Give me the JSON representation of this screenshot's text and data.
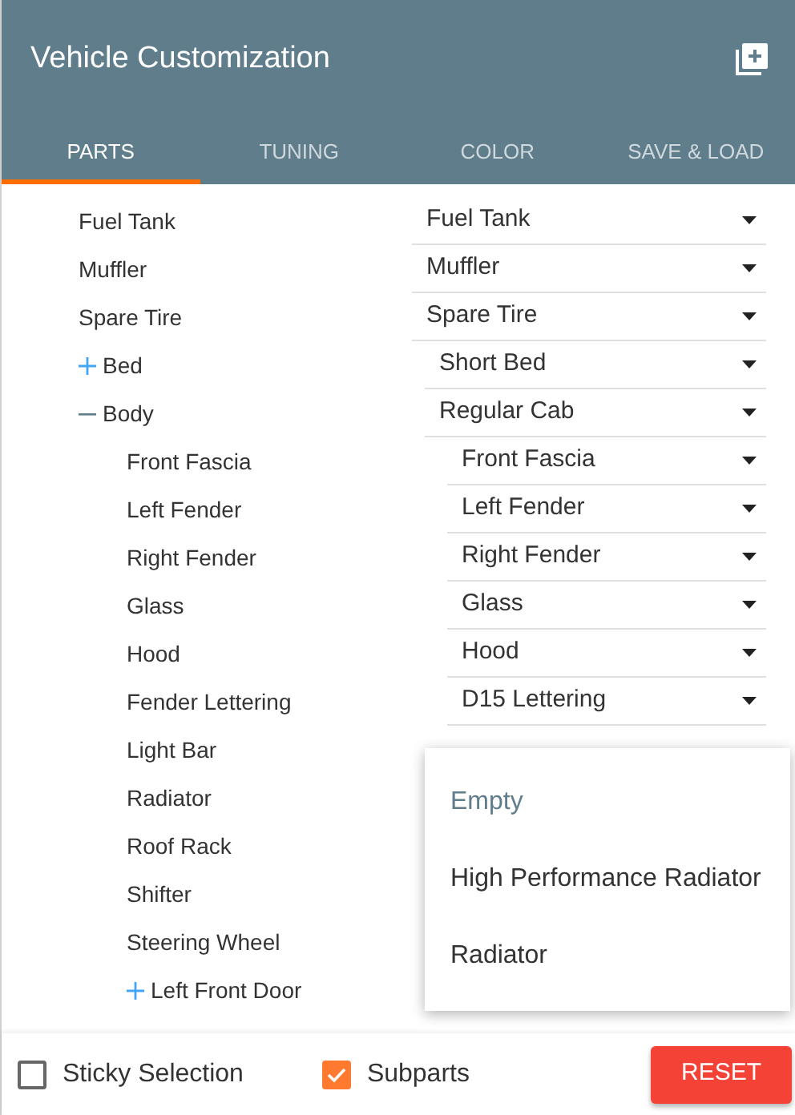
{
  "header": {
    "title": "Vehicle Customization"
  },
  "tabs": [
    {
      "label": "PARTS",
      "selected": true
    },
    {
      "label": "TUNING",
      "selected": false
    },
    {
      "label": "COLOR",
      "selected": false
    },
    {
      "label": "SAVE & LOAD",
      "selected": false
    }
  ],
  "parts": [
    {
      "label": "Fuel Tank",
      "value": "Fuel Tank"
    },
    {
      "label": "Muffler",
      "value": "Muffler"
    },
    {
      "label": "Spare Tire",
      "value": "Spare Tire"
    },
    {
      "label": "Bed",
      "expanded": false,
      "value": "Short Bed"
    },
    {
      "label": "Body",
      "expanded": true,
      "value": "Regular Cab",
      "children": [
        {
          "label": "Front Fascia",
          "value": "Front Fascia"
        },
        {
          "label": "Left Fender",
          "value": "Left Fender"
        },
        {
          "label": "Right Fender",
          "value": "Right Fender"
        },
        {
          "label": "Glass",
          "value": "Glass"
        },
        {
          "label": "Hood",
          "value": "Hood"
        },
        {
          "label": "Fender Lettering",
          "value": "D15 Lettering"
        },
        {
          "label": "Light Bar"
        },
        {
          "label": "Radiator"
        },
        {
          "label": "Roof Rack"
        },
        {
          "label": "Shifter"
        },
        {
          "label": "Steering Wheel"
        },
        {
          "label": "Left Front Door",
          "expanded": false
        }
      ]
    }
  ],
  "dropdown": {
    "options": [
      {
        "label": "Empty",
        "selected": true
      },
      {
        "label": "High Performance Radiator",
        "selected": false
      },
      {
        "label": "Radiator",
        "selected": false
      }
    ]
  },
  "footer": {
    "sticky_selection": {
      "label": "Sticky Selection",
      "checked": false
    },
    "subparts": {
      "label": "Subparts",
      "checked": true
    },
    "reset": "RESET"
  }
}
